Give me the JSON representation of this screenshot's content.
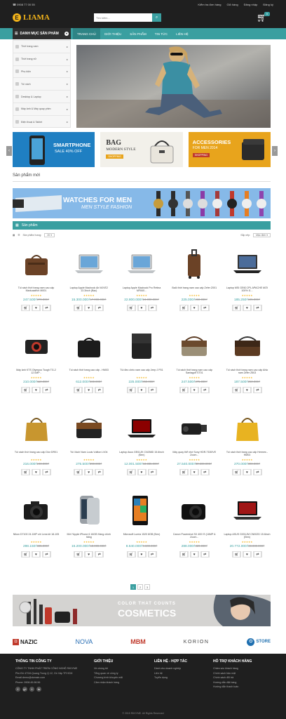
{
  "topbar": {
    "phone": "0908 77 00 55",
    "links": [
      "Kiểm tra đơn hàng",
      "Giỏ hàng",
      "Đăng nhập",
      "Đăng ký"
    ]
  },
  "header": {
    "logo_letter": "E",
    "logo_text": "LIAMA",
    "search_placeholder": "Tìm kiếm...",
    "cart_count": "0"
  },
  "nav": {
    "category_label": "DANH MỤC SẢN PHẨM",
    "items": [
      "TRANG CHỦ",
      "GIỚI THIỆU",
      "SẢN PHẨM",
      "TIN TỨC",
      "LIÊN HỆ"
    ]
  },
  "categories": [
    "Thời trang nam",
    "Thời trang nữ",
    "Phụ kiện",
    "Túi xách",
    "Desktop & Laptop",
    "Máy ảnh & Máy quay phim",
    "Điện thoại & Tablet"
  ],
  "banners": {
    "b1_title": "SMARTPHONE",
    "b1_sub": "SALE 40% OFF",
    "b2_title": "BAG",
    "b2_sub": "MODERN STYLE",
    "b2_btn": "SHOPPING",
    "b3_title": "ACCESSORIES",
    "b3_sub": "FOR MEN 2014",
    "b3_btn": "SHOPPING"
  },
  "new_products_title": "Sản phẩm mới",
  "watch_banner": {
    "title": "WATCHES FOR MEN",
    "sub": "MEN STYLE FASHION"
  },
  "products_section": {
    "title": "Sản phẩm",
    "per_page_label": "Sản phẩm/ trang:",
    "per_page_value": "20",
    "sort_label": "Sắp xếp:",
    "sort_value": "Mặc định"
  },
  "products": [
    {
      "name": "Túi xách thời trang nam cao cấp Markusaffon M001",
      "price": "247.500₫",
      "old": "370.000₫",
      "kind": "bag-brown"
    },
    {
      "name": "Laptop Apple Macbook Air MJVE2 13.3inch (Bạc)",
      "price": "15.300.000₫",
      "old": "17.000.000₫",
      "kind": "laptop-silver"
    },
    {
      "name": "Laptop Apple Macbook Pro Retina MF840...",
      "price": "22.800.000₫",
      "old": "24.000.000₫",
      "kind": "laptop-silver"
    },
    {
      "name": "Balô thời trang nam cao cấp Zefer Z001",
      "price": "225.000₫",
      "old": "260.000₫",
      "kind": "luggage"
    },
    {
      "name": "Laptop MSI GE60 2PL APACHE MỚI 100% I1...",
      "price": "185.250₫",
      "old": "195.000₫",
      "kind": "laptop-dark"
    },
    {
      "name": "Máy ảnh KTS Olympus Tough TG-2 12.0MP -",
      "price": "210.000₫",
      "old": "110.000₫",
      "kind": "camera-red"
    },
    {
      "name": "Túi xách thời trang cao cấp - HM03",
      "price": "612.000₫",
      "old": "680.000₫",
      "kind": "bag-black"
    },
    {
      "name": "Túi đeo chéo nam cao cấp Jeep J P01",
      "price": "225.000₫",
      "old": "250.000₫",
      "kind": "bag-black2"
    },
    {
      "name": "Túi xách thời trang nam cao cấp Santagolf ST01",
      "price": "247.500₫",
      "old": "275.000₫",
      "kind": "bag-khaki"
    },
    {
      "name": "Túi xách thời trang nam cao cấp Ahlo nam Zefer Z503",
      "price": "187.500₫",
      "old": "250.000₫",
      "kind": "bag-brown2"
    },
    {
      "name": "Túi xách thời trang cao cấp Dior DR01",
      "price": "216.000₫",
      "old": "240.000₫",
      "kind": "bag-tan"
    },
    {
      "name": "Túi Xách Nam Louis Vuitton LV04",
      "price": "275.500₫",
      "old": "390.000₫",
      "kind": "bag-black-brown"
    },
    {
      "name": "Laptop Asus GE61JK CN258D 15.6inch (Đen)",
      "price": "12.001.500₫",
      "old": "13.335.000₫",
      "kind": "laptop-red"
    },
    {
      "name": "Máy quay thể nhớ Sony HDR-TD30VE Zoom...",
      "price": "27.540.000₫",
      "old": "30.600.000₫",
      "kind": "camcorder"
    },
    {
      "name": "Túi xách thời trang cao cấp Hermes - HM03",
      "price": "270.000₫",
      "old": "300.000₫",
      "kind": "bag-yellow"
    },
    {
      "name": "Nikon D7100 24.1MP với Lens kit 18-105",
      "price": "298.150₫",
      "old": "335.000₫",
      "kind": "dslr"
    },
    {
      "name": "Mới *Apple iPhone 6 16GB Hàng chính hãng",
      "price": "16.200.000₫",
      "old": "18.000.000₫",
      "kind": "iphone"
    },
    {
      "name": "Microsoft Lumia 1520 8GB (Đen)",
      "price": "8.640.000₫",
      "old": "9.600.000₫",
      "kind": "lumia"
    },
    {
      "name": "Canon Powershot SX 400 IS (16MP & Zoom...",
      "price": "288.000₫",
      "old": "320.000₫",
      "kind": "canon"
    },
    {
      "name": "Laptop ASUS GX51JM CN002D 15.6inch (Đen)",
      "price": "20.772.000₫",
      "old": "23.080.000₫",
      "kind": "laptop-red2"
    }
  ],
  "pager": [
    "1",
    "2",
    "3"
  ],
  "cosmetics_banner": {
    "line1": "COLOR THAT COUNTS",
    "line2": "COSMETICS"
  },
  "brands": [
    "NAZIC",
    "NOVA",
    "MBM",
    "KORION",
    "STORE"
  ],
  "footer": {
    "c1_title": "THÔNG TIN CÔNG TY",
    "c1_lines": [
      "CÔNG TY TNHH PHÁT TRIỂN CÔNG NGHỆ RIKIYME",
      "Phú Đô 47/2A Quang Trung Q.12, Gò Vấp TP.HCM",
      "Email:demo@domain.com",
      "Phone: 0908.45.98.56"
    ],
    "c2_title": "GIỚI THIỆU",
    "c2_lines": [
      "Về chúng tôi",
      "Tổng quan về công ty",
      "Chương trình khuyến mãi",
      "Cảm nhận khách hàng"
    ],
    "c3_title": "LIÊN HỆ - HỢP TÁC",
    "c3_lines": [
      "Dành cho doanh nghiệp",
      "Liên hệ",
      "Tuyển dụng"
    ],
    "c4_title": "HỖ TRỢ KHÁCH HÀNG",
    "c4_lines": [
      "Chăm sóc khách hàng",
      "Chính sách bảo mật",
      "Chính sách đổi trả",
      "Hướng dẫn đặt hàng",
      "Hướng dẫn thanh toán"
    ],
    "social": [
      "f",
      "g+",
      "t",
      "in"
    ],
    "copyright": "© 2015 RIKIYME. All Rights Reserved"
  },
  "colors": {
    "accent": "#3a9fa0",
    "dark": "#1f1f1f",
    "gold": "#f2b31a"
  }
}
